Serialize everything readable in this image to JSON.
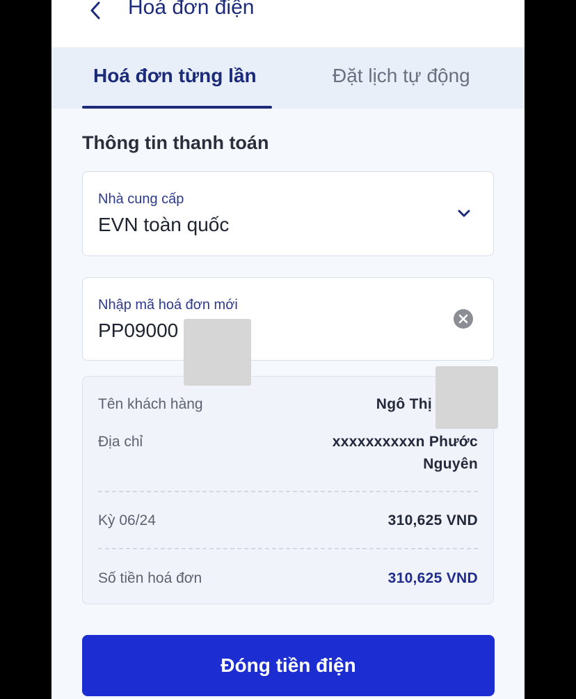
{
  "header": {
    "title": "Hoá đơn điện",
    "back_icon": "chevron-left-icon"
  },
  "tabs": [
    {
      "label": "Hoá đơn từng lần",
      "active": true
    },
    {
      "label": "Đặt lịch tự động",
      "active": false
    }
  ],
  "payment": {
    "section_title": "Thông tin thanh toán",
    "provider": {
      "label": "Nhà cung cấp",
      "value": "EVN toàn quốc",
      "icon": "chevron-down-icon"
    },
    "bill_code": {
      "label": "Nhập mã hoá đơn mới",
      "value": "PP09000",
      "icon": "clear-icon"
    }
  },
  "details": {
    "customer": {
      "label": "Tên khách hàng",
      "value": "Ngô Thị"
    },
    "address": {
      "label": "Địa chỉ",
      "value_line1": "xxxxxxxxxxn Phước",
      "value_line2": "Nguyên"
    },
    "period": {
      "label": "Kỳ 06/24",
      "value": "310,625 VND"
    },
    "amount": {
      "label": "Số tiền hoá đơn",
      "value": "310,625 VND"
    }
  },
  "action": {
    "pay_label": "Đóng tiền điện"
  },
  "colors": {
    "primary": "#1c2ed2",
    "title": "#1c2a7a",
    "background": "#f5f8fd"
  }
}
